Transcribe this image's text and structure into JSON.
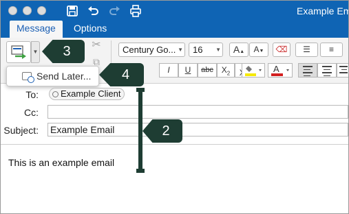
{
  "window": {
    "title": "Example Ema",
    "accent_color": "#0f64b4",
    "icons": [
      "close-icon",
      "minimize-icon",
      "zoom-icon",
      "save-icon",
      "undo-icon",
      "redo-icon",
      "print-icon"
    ]
  },
  "tabs": [
    {
      "label": "Message",
      "active": true
    },
    {
      "label": "Options",
      "active": false
    }
  ],
  "ribbon": {
    "font_family_value": "Century Go...",
    "font_size_value": "16",
    "grow_label": "A",
    "shrink_label": "A",
    "italic_label": "I",
    "underline_label": "U",
    "strike_label": "abc",
    "subscript_label": "X2",
    "superscript_label": "X2"
  },
  "dropdown": {
    "item_label": "Send Later..."
  },
  "fields": {
    "to_label": "To:",
    "to_recipient": "Example Client",
    "cc_label": "Cc:",
    "cc_value": "",
    "subject_label": "Subject:",
    "subject_value": "Example Email"
  },
  "body": {
    "text": "This is an example email"
  },
  "annotations": [
    {
      "number": "3",
      "color": "#1e3d33"
    },
    {
      "number": "4",
      "color": "#1e3d33"
    },
    {
      "number": "2",
      "color": "#1e3d33"
    }
  ]
}
